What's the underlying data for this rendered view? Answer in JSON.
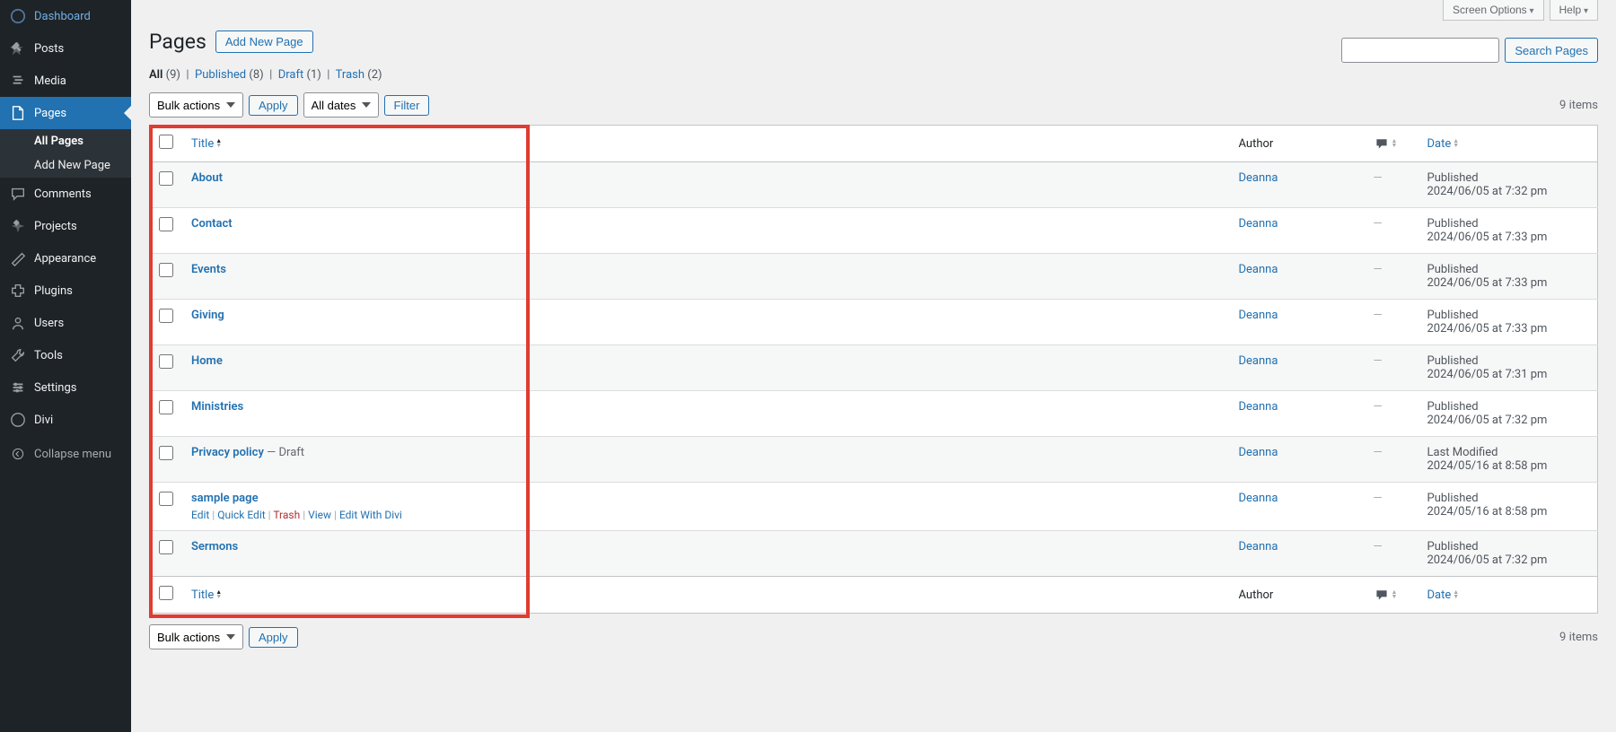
{
  "sidebar": {
    "items": [
      {
        "label": "Dashboard",
        "icon": "dashboard"
      },
      {
        "label": "Posts",
        "icon": "pin"
      },
      {
        "label": "Media",
        "icon": "media"
      },
      {
        "label": "Pages",
        "icon": "pages",
        "current": true
      },
      {
        "label": "Comments",
        "icon": "comments"
      },
      {
        "label": "Projects",
        "icon": "projects"
      },
      {
        "label": "Appearance",
        "icon": "appearance"
      },
      {
        "label": "Plugins",
        "icon": "plugins"
      },
      {
        "label": "Users",
        "icon": "users"
      },
      {
        "label": "Tools",
        "icon": "tools"
      },
      {
        "label": "Settings",
        "icon": "settings"
      },
      {
        "label": "Divi",
        "icon": "divi"
      }
    ],
    "submenu": [
      {
        "label": "All Pages",
        "active": true
      },
      {
        "label": "Add New Page"
      }
    ],
    "collapse": "Collapse menu"
  },
  "screen_tabs": {
    "screen_options": "Screen Options",
    "help": "Help"
  },
  "heading": "Pages",
  "add_new": "Add New Page",
  "filters": {
    "all": "All",
    "all_count": "(9)",
    "published": "Published",
    "published_count": "(8)",
    "draft": "Draft",
    "draft_count": "(1)",
    "trash": "Trash",
    "trash_count": "(2)"
  },
  "bulk_actions": "Bulk actions",
  "apply": "Apply",
  "all_dates": "All dates",
  "filter": "Filter",
  "items_text": "9 items",
  "search_btn": "Search Pages",
  "columns": {
    "title": "Title",
    "author": "Author",
    "date": "Date"
  },
  "rows": [
    {
      "title": "About",
      "author": "Deanna",
      "status": "Published",
      "date": "2024/06/05 at 7:32 pm"
    },
    {
      "title": "Contact",
      "author": "Deanna",
      "status": "Published",
      "date": "2024/06/05 at 7:33 pm"
    },
    {
      "title": "Events",
      "author": "Deanna",
      "status": "Published",
      "date": "2024/06/05 at 7:33 pm"
    },
    {
      "title": "Giving",
      "author": "Deanna",
      "status": "Published",
      "date": "2024/06/05 at 7:33 pm"
    },
    {
      "title": "Home",
      "author": "Deanna",
      "status": "Published",
      "date": "2024/06/05 at 7:31 pm"
    },
    {
      "title": "Ministries",
      "author": "Deanna",
      "status": "Published",
      "date": "2024/06/05 at 7:32 pm"
    },
    {
      "title": "Privacy policy",
      "draft": " — Draft",
      "author": "Deanna",
      "status": "Last Modified",
      "date": "2024/05/16 at 8:58 pm"
    },
    {
      "title": "sample page",
      "hover": true,
      "author": "Deanna",
      "status": "Published",
      "date": "2024/05/16 at 8:58 pm"
    },
    {
      "title": "Sermons",
      "author": "Deanna",
      "status": "Published",
      "date": "2024/06/05 at 7:32 pm"
    }
  ],
  "row_actions": {
    "edit": "Edit",
    "quick_edit": "Quick Edit",
    "trash": "Trash",
    "view": "View",
    "edit_divi": "Edit With Divi"
  },
  "dash": "—"
}
